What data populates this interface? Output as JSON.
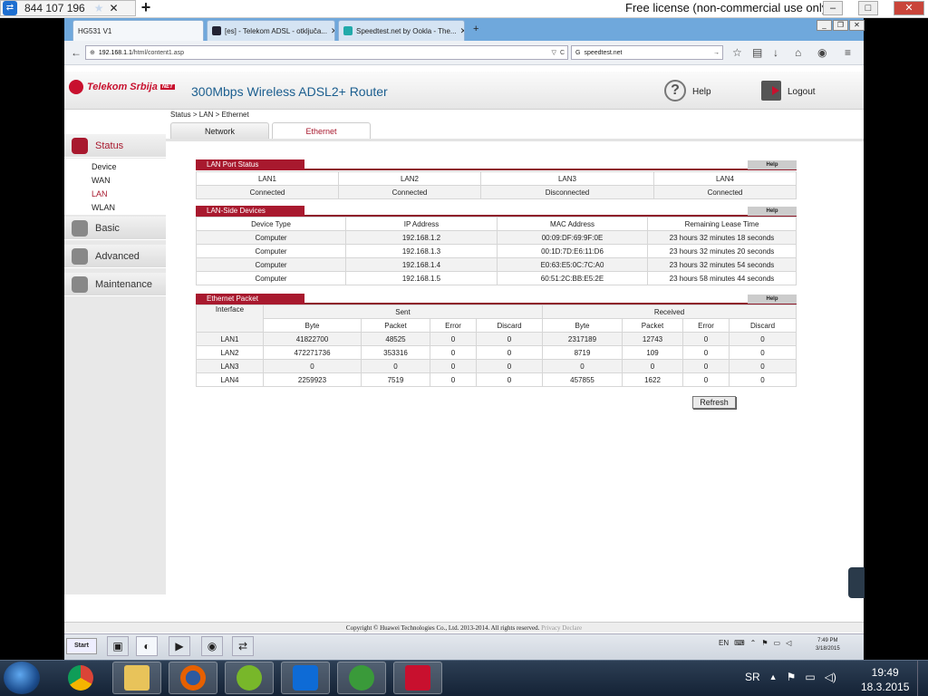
{
  "teamviewer": {
    "partner_id": "844 107 196",
    "license_text": "Free license (non-commercial use only)"
  },
  "browser": {
    "tabs": [
      {
        "label": "HG531 V1"
      },
      {
        "label": "[es] - Telekom ADSL - otključa..."
      },
      {
        "label": "Speedtest.net by Ookla - The..."
      }
    ],
    "url_host": "192.168.1.1",
    "url_path": "/html/content1.asp",
    "search_value": "speedtest.net"
  },
  "router": {
    "brand": "Telekom Srbija",
    "brand_tag": "NET",
    "title": "300Mbps Wireless ADSL2+ Router",
    "help_label": "Help",
    "logout_label": "Logout",
    "breadcrumb": "Status > LAN > Ethernet",
    "tabs": {
      "network": "Network",
      "ethernet": "Ethernet"
    },
    "menu": {
      "status": "Status",
      "status_sub": [
        "Device",
        "WAN",
        "LAN",
        "WLAN"
      ],
      "basic": "Basic",
      "advanced": "Advanced",
      "maintenance": "Maintenance"
    },
    "help_btn": "Help",
    "lan_port_status": {
      "title": "LAN Port Status",
      "headers": [
        "LAN1",
        "LAN2",
        "LAN3",
        "LAN4"
      ],
      "values": [
        "Connected",
        "Connected",
        "Disconnected",
        "Connected"
      ]
    },
    "lan_side_devices": {
      "title": "LAN-Side Devices",
      "headers": [
        "Device Type",
        "IP Address",
        "MAC Address",
        "Remaining Lease Time"
      ],
      "rows": [
        [
          "Computer",
          "192.168.1.2",
          "00:09:DF:69:9F:0E",
          "23 hours 32 minutes 18 seconds"
        ],
        [
          "Computer",
          "192.168.1.3",
          "00:1D:7D:E6:11:D6",
          "23 hours 32 minutes 20 seconds"
        ],
        [
          "Computer",
          "192.168.1.4",
          "E0:63:E5:0C:7C:A0",
          "23 hours 32 minutes 54 seconds"
        ],
        [
          "Computer",
          "192.168.1.5",
          "60:51:2C:BB:E5:2E",
          "23 hours 58 minutes 44 seconds"
        ]
      ]
    },
    "ethernet_packet": {
      "title": "Ethernet Packet",
      "interface_header": "Interface",
      "sent_header": "Sent",
      "received_header": "Received",
      "sub_headers": [
        "Byte",
        "Packet",
        "Error",
        "Discard",
        "Byte",
        "Packet",
        "Error",
        "Discard"
      ],
      "rows": [
        [
          "LAN1",
          "41822700",
          "48525",
          "0",
          "0",
          "2317189",
          "12743",
          "0",
          "0"
        ],
        [
          "LAN2",
          "472271736",
          "353316",
          "0",
          "0",
          "8719",
          "109",
          "0",
          "0"
        ],
        [
          "LAN3",
          "0",
          "0",
          "0",
          "0",
          "0",
          "0",
          "0",
          "0"
        ],
        [
          "LAN4",
          "2259923",
          "7519",
          "0",
          "0",
          "457855",
          "1622",
          "0",
          "0"
        ]
      ]
    },
    "refresh_label": "Refresh",
    "footer": "Copyright © Huawei Technologies Co., Ltd. 2013-2014. All rights reserved.",
    "footer_link": "Privacy Declare"
  },
  "inner_taskbar": {
    "start": "Start",
    "lang": "EN",
    "time": "7:49 PM",
    "date": "3/18/2015"
  },
  "outer_taskbar": {
    "lang": "SR",
    "time": "19:49",
    "date": "18.3.2015"
  },
  "colors": {
    "accent": "#a8192e",
    "title_blue": "#1b5e8f"
  }
}
